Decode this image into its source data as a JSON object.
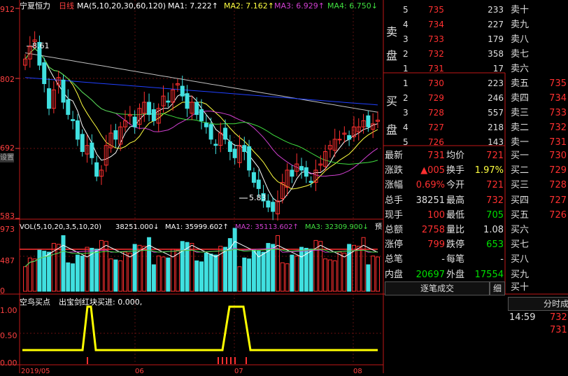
{
  "axis": {
    "price": [
      "912",
      "802",
      "692",
      "583"
    ],
    "volume": [
      "973",
      "487",
      "0"
    ],
    "indicator": [
      "1.00",
      "0.50",
      "0.00"
    ],
    "date_row": [
      "2019/05",
      "06",
      "07",
      "08"
    ],
    "series_label": "设置"
  },
  "main_header": {
    "stock": "宁夏恒力",
    "period": "日线",
    "ma_def": "MA(5,10,20,30,60,120)",
    "ma1": "MA1: 7.222↑",
    "ma2": "MA2: 7.162↑",
    "ma3": "MA3: 6.929↑",
    "ma4": "MA4: 6.750↓"
  },
  "annotations": {
    "high": "8.61",
    "low": "5.83"
  },
  "vol_header": {
    "def": "VOL(5,10,20,3,5,10,20)",
    "value": "38251.000↓",
    "ma1": "MA1: 35999.602↑",
    "ma2": "MA2: 35113.602↑",
    "ma3": "MA3: 32309.900↓",
    "extra": "预"
  },
  "ind_header": {
    "name": "空鸟买点",
    "sub": "出宝剑红块买进: 0.000,"
  },
  "orderbook": {
    "sell_label": [
      "卖",
      "盘"
    ],
    "buy_label": [
      "买",
      "盘"
    ],
    "sells": [
      {
        "n": "5",
        "p": "735",
        "v": "233",
        "t": "卖十"
      },
      {
        "n": "4",
        "p": "734",
        "v": "227",
        "t": "卖九"
      },
      {
        "n": "3",
        "p": "733",
        "v": "179",
        "t": "卖八"
      },
      {
        "n": "2",
        "p": "732",
        "v": "358",
        "t": "卖七"
      },
      {
        "n": "1",
        "p": "731",
        "v": "17",
        "t": "卖六"
      }
    ],
    "buys": [
      {
        "n": "1",
        "p": "730",
        "v": "223",
        "t": "卖五",
        "r": "735"
      },
      {
        "n": "2",
        "p": "729",
        "v": "246",
        "t": "卖四",
        "r": "734"
      },
      {
        "n": "3",
        "p": "728",
        "v": "557",
        "t": "卖三",
        "r": "733"
      },
      {
        "n": "4",
        "p": "727",
        "v": "218",
        "t": "卖二",
        "r": "732"
      },
      {
        "n": "5",
        "p": "726",
        "v": "143",
        "t": "卖一",
        "r": "731"
      }
    ]
  },
  "quote": {
    "rows": [
      {
        "l1": "最新",
        "v1": "731",
        "l2": "均价",
        "v2": "721",
        "t": "买一",
        "r": "730"
      },
      {
        "l1": "涨跌",
        "v1": "▲005",
        "l2": "换手",
        "v2": "1.97%",
        "t": "买二",
        "r": "729"
      },
      {
        "l1": "涨幅",
        "v1": "0.69%",
        "l2": "今开",
        "v2": "721",
        "t": "买三",
        "r": "728"
      },
      {
        "l1": "总手",
        "v1": "38251",
        "l2": "最高",
        "v2": "732",
        "t": "买四",
        "r": "727"
      },
      {
        "l1": "现手",
        "v1": "100",
        "l2": "最低",
        "v2": "705",
        "t": "买五",
        "r": "726"
      },
      {
        "l1": "总额",
        "v1": "2758",
        "l2": "量比",
        "v2": "1.08",
        "t": "买六",
        "r": ""
      },
      {
        "l1": "涨停",
        "v1": "799",
        "l2": "跌停",
        "v2": "653",
        "t": "买七",
        "r": ""
      },
      {
        "l1": "总笔",
        "v1": "-",
        "l2": "每笔",
        "v2": "-",
        "t": "买八",
        "r": ""
      },
      {
        "l1": "内盘",
        "v1": "20697",
        "l2": "外盘",
        "v2": "17554",
        "t": "买九",
        "r": ""
      }
    ],
    "extra_right": "买十"
  },
  "tabs": {
    "tick": "逐笔成交",
    "detail": "细",
    "minute": "分时成"
  },
  "trades": [
    {
      "time": "14:59",
      "price": "732"
    },
    {
      "time": "",
      "price": "731"
    }
  ],
  "colors": {
    "red": "#ff3030",
    "green": "#00e000",
    "cyan": "#40e0e0",
    "white": "#ffffff",
    "yellow": "#ffff00",
    "magenta": "#d040d0",
    "blue": "#2040ff"
  }
}
